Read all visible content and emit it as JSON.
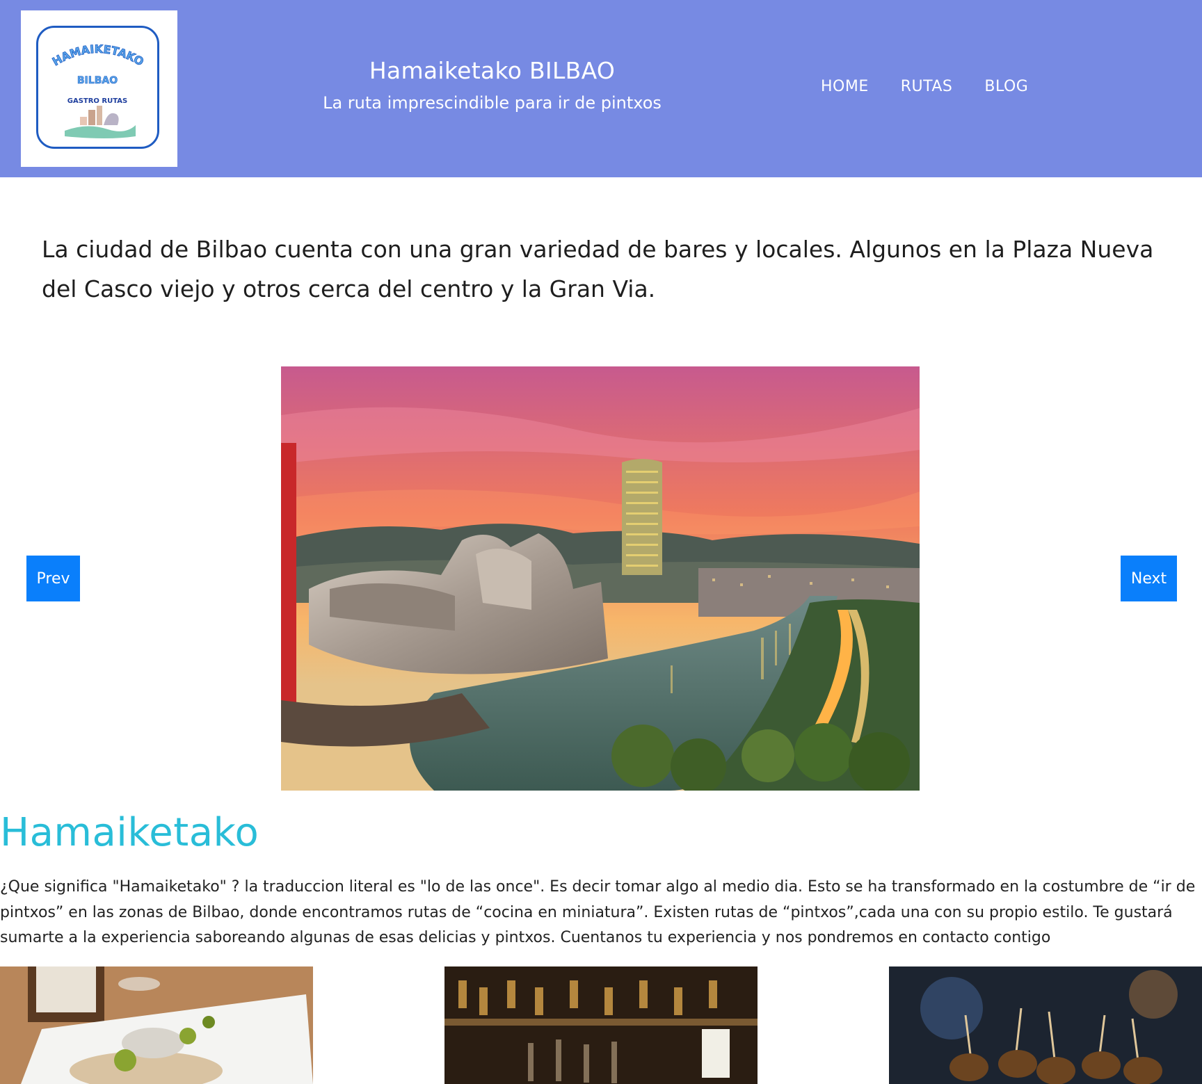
{
  "header": {
    "logo": {
      "line1": "HAMAIKETAKO",
      "line2": "BILBAO",
      "line3": "GASTRO RUTAS"
    },
    "title": "Hamaiketako BILBAO",
    "tagline": "La ruta imprescindible para ir de pintxos",
    "nav": [
      "HOME",
      "RUTAS",
      "BLOG"
    ]
  },
  "intro": "La ciudad de Bilbao cuenta con una gran variedad de bares y locales. Algunos en la Plaza Nueva del Casco viejo y otros cerca del centro y la Gran Via.",
  "carousel": {
    "prev_label": "Prev",
    "next_label": "Next"
  },
  "section": {
    "title": "Hamaiketako",
    "text": "¿Que significa \"Hamaiketako\" ? la traduccion literal es \"lo de las once\". Es decir tomar algo al medio dia. Esto se ha transformado en la costumbre de “ir de pintxos” en las zonas de Bilbao, donde encontramos rutas de “cocina en miniatura”. Existen rutas de “pintxos”,cada una con su propio estilo. Te gustará sumarte a la experiencia saboreando algunas de esas delicias y pintxos. Cuentanos tu experiencia y nos pondremos en contacto contigo"
  },
  "colors": {
    "header_bg": "#778ae3",
    "accent_title": "#29bdd8",
    "button_bg": "#0a7ffb"
  }
}
